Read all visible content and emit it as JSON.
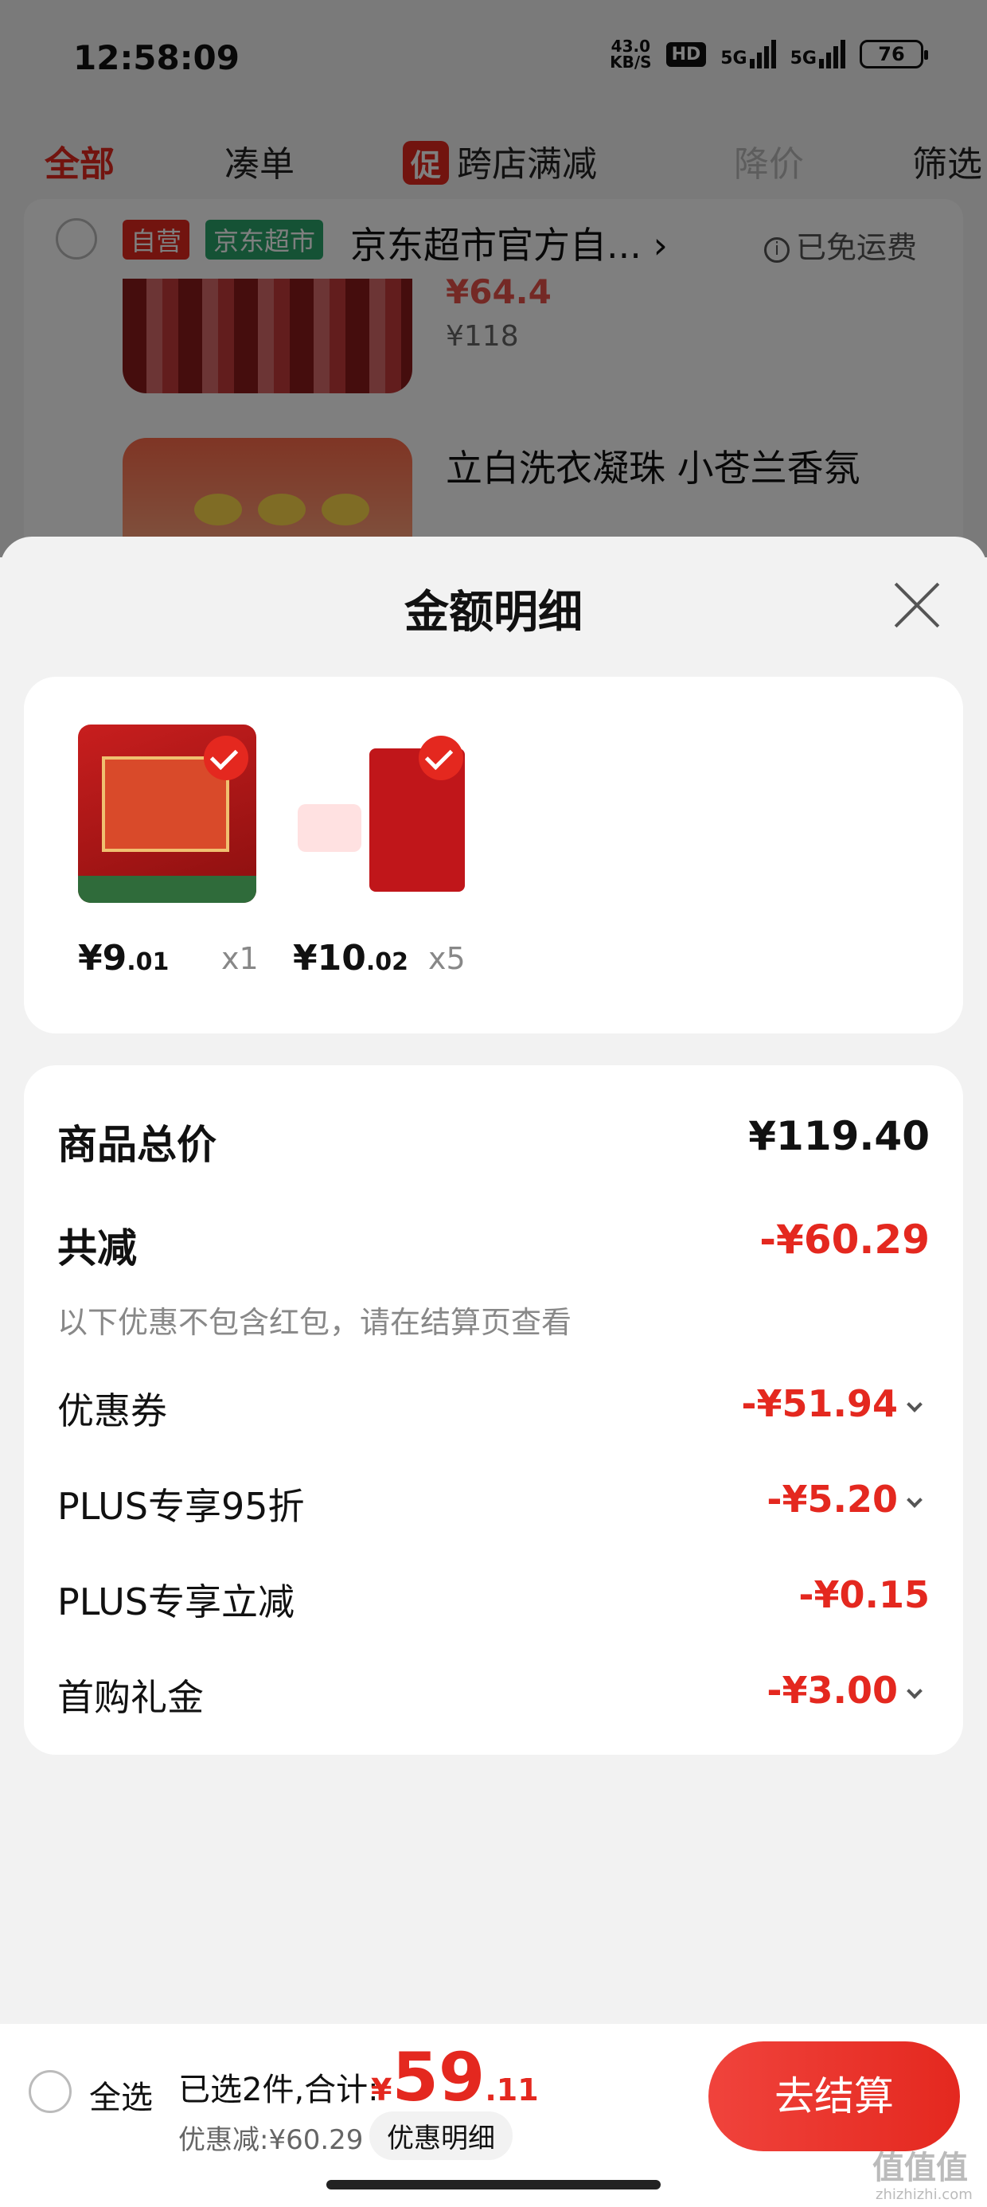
{
  "status_bar": {
    "time": "12:58:09",
    "net_speed": "43.0",
    "net_unit": "KB/S",
    "hd": "HD",
    "sig1": "5G",
    "sig2": "5G",
    "battery": "76"
  },
  "filter_tabs": {
    "all": "全部",
    "combine": "凑单",
    "promo_tag": "促",
    "cross_store": "跨店满减",
    "price_drop": "降价",
    "filter": "筛选"
  },
  "shop": {
    "tag_self": "自营",
    "tag_market": "京东超市",
    "name": "京东超市官方自...",
    "arrow": "›",
    "shipping": "已免运费",
    "item1_price_partial": "¥64.4",
    "item1_old_price": "¥118",
    "item2_name": "立白洗衣凝珠 小苍兰香氛"
  },
  "sheet": {
    "title": "金额明细",
    "items": [
      {
        "price_int": "¥9",
        "price_dec": ".01",
        "qty": "x1"
      },
      {
        "price_int": "¥10",
        "price_dec": ".02",
        "qty": "x5"
      }
    ],
    "summary": {
      "total_label": "商品总价",
      "total_value": "¥119.40",
      "reduce_label": "共减",
      "reduce_value": "-¥60.29",
      "note": "以下优惠不包含红包，请在结算页查看",
      "coupon_label": "优惠券",
      "coupon_value": "-¥51.94",
      "plus95_label": "PLUS专享95折",
      "plus95_value": "-¥5.20",
      "plusinst_label": "PLUS专享立减",
      "plusinst_value": "-¥0.15",
      "firstbuy_label": "首购礼金",
      "firstbuy_value": "-¥3.00"
    }
  },
  "bottom_bar": {
    "select_all": "全选",
    "selected_text": "已选2件,合计:",
    "total_currency": "¥",
    "total_int": "59",
    "total_dec": ".11",
    "discount_text": "优惠减:¥60.29",
    "detail_button": "优惠明细",
    "checkout_button": "去结算"
  },
  "watermark": {
    "main": "值值值",
    "sub": "zhizhizhi.com"
  },
  "colors": {
    "accent": "#e4281f",
    "green": "#2aa56b"
  }
}
